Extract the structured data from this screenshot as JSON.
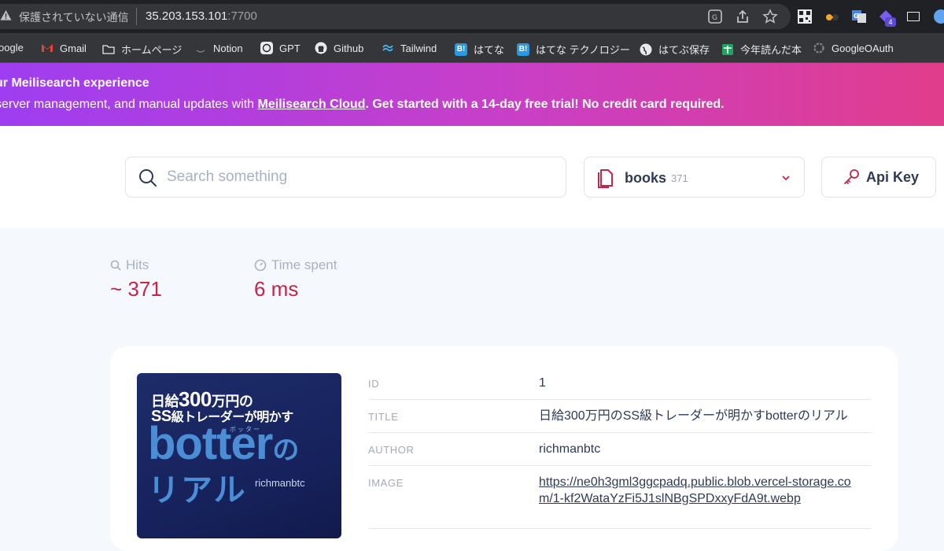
{
  "browser": {
    "insecure_label": "保護されていない通信",
    "url_host": "35.203.153.101",
    "url_port": ":7700",
    "bookmarks": [
      {
        "label": "oogle"
      },
      {
        "label": "Gmail"
      },
      {
        "label": "ホームページ"
      },
      {
        "label": "Notion"
      },
      {
        "label": "GPT"
      },
      {
        "label": "Github"
      },
      {
        "label": "Tailwind"
      },
      {
        "label": "はてな"
      },
      {
        "label": "はてな テクノロジー"
      },
      {
        "label": "はてぶ保存"
      },
      {
        "label": "今年読んだ本"
      },
      {
        "label": "GoogleOAuth"
      }
    ],
    "hatena_badge": "B!",
    "ext_badge": "4"
  },
  "banner": {
    "title": "ur Meilisearch experience",
    "text_before": "server management, and manual updates with ",
    "link": "Meilisearch Cloud",
    "text_after": ". Get started with a 14-day free trial! No credit card required."
  },
  "header": {
    "search_placeholder": "Search something",
    "index_name": "books",
    "index_count": "371",
    "api_key_label": "Api Key"
  },
  "stats": {
    "hits_label": "Hits",
    "hits_value": "~ 371",
    "time_label": "Time spent",
    "time_value": "6 ms"
  },
  "result": {
    "cover": {
      "line1_a": "日給",
      "line1_b": "300",
      "line1_c": "万円の",
      "line2_a": "SS",
      "line2_b": "級トレーダーが明かす",
      "ruby": "ボッター",
      "title": "botter",
      "title_suffix": "の",
      "sub": "リアル",
      "author": "richmanbtc"
    },
    "fields": [
      {
        "key": "ID",
        "value": "1"
      },
      {
        "key": "TITLE",
        "value": "日給300万円のSS級トレーダーが明かすbotterのリアル"
      },
      {
        "key": "AUTHOR",
        "value": "richmanbtc"
      },
      {
        "key": "IMAGE",
        "value": "https://ne0h3gml3ggcpadq.public.blob.vercel-storage.com/1-kf2WataYzFi5J1slNBgSPDxxyFdA9t.webp"
      }
    ]
  },
  "colors": {
    "accent": "#c4254a",
    "banner_start": "#9e3ef1",
    "banner_end": "#e13d8c"
  }
}
